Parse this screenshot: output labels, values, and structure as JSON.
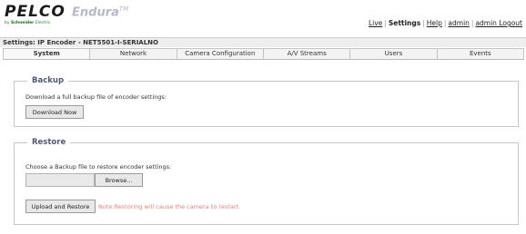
{
  "header": {
    "logo_text": "PELCO",
    "product_name": "Endura",
    "product_mark": "TM",
    "byline_prefix": "by",
    "byline_brand": "Schneider",
    "byline_suffix": "Electric",
    "nav": [
      {
        "label": "Live",
        "active": false
      },
      {
        "label": "Settings",
        "active": true
      },
      {
        "label": "Help",
        "active": false
      },
      {
        "label": "admin",
        "active": false
      },
      {
        "label": "admin Logout",
        "active": false
      }
    ]
  },
  "title": "Settings: IP Encoder - NET5501-I-SERIALNO",
  "tabs": [
    "System",
    "Network",
    "Camera Configuration",
    "A/V Streams",
    "Users",
    "Events"
  ],
  "backup": {
    "legend": "Backup",
    "description": "Download a full backup file of encoder settings:",
    "button": "Download Now"
  },
  "restore": {
    "legend": "Restore",
    "description": "Choose a Backup file to restore encoder settings:",
    "browse_button": "Browse...",
    "file_value": "",
    "upload_button": "Upload and Restore",
    "note": "Note:Restoring will cause the camera to restart."
  },
  "colors": {
    "note": "#e88080",
    "legend": "#555577",
    "endura": "#b6b8c8"
  }
}
